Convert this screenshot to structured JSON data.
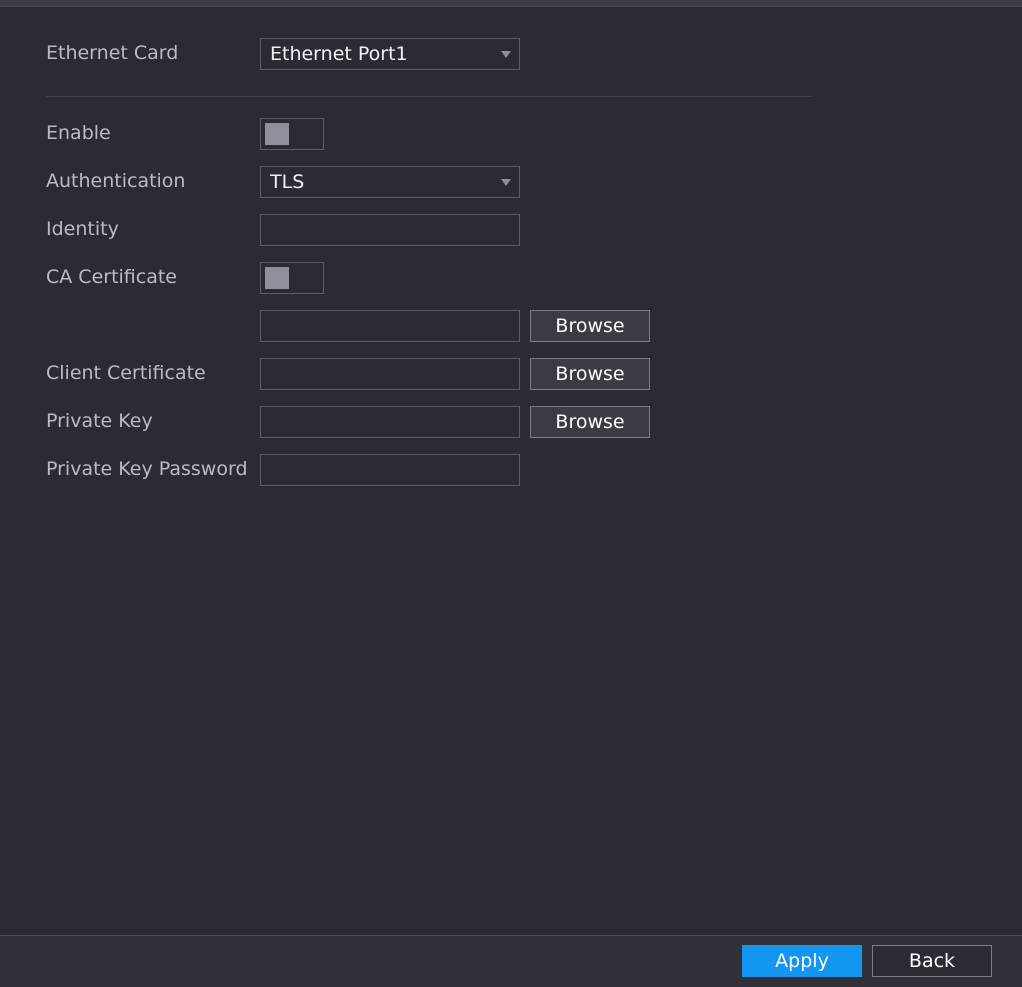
{
  "ethernet_card": {
    "label": "Ethernet Card",
    "selected": "Ethernet Port1"
  },
  "enable": {
    "label": "Enable",
    "on": false
  },
  "authentication": {
    "label": "Authentication",
    "selected": "TLS"
  },
  "identity": {
    "label": "Identity",
    "value": ""
  },
  "ca_certificate": {
    "label": "CA Certificate",
    "on": false,
    "path_value": "",
    "browse_label": "Browse"
  },
  "client_certificate": {
    "label": "Client Certificate",
    "path_value": "",
    "browse_label": "Browse"
  },
  "private_key": {
    "label": "Private Key",
    "path_value": "",
    "browse_label": "Browse"
  },
  "private_key_password": {
    "label": "Private Key Password",
    "value": ""
  },
  "footer": {
    "apply_label": "Apply",
    "back_label": "Back"
  },
  "colors": {
    "background": "#2a2b33",
    "accent": "#1296f0",
    "label_text": "#b9bcc4"
  }
}
